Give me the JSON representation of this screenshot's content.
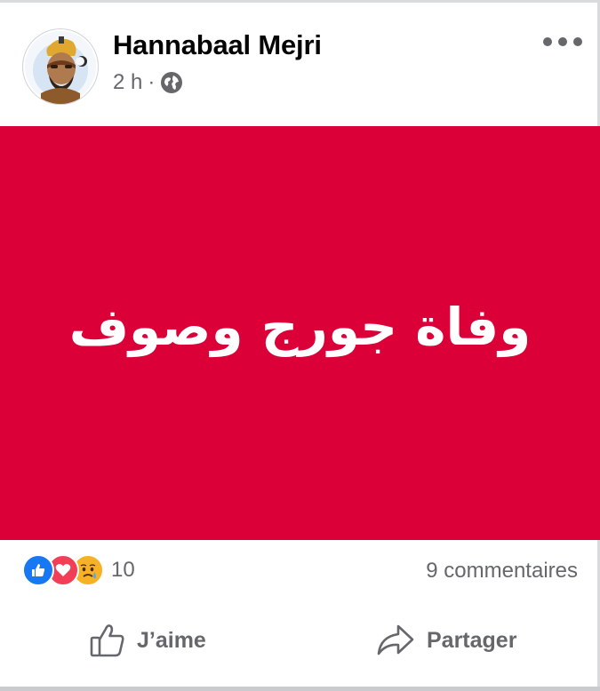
{
  "post": {
    "author": "Hannabaal Mejri",
    "time": "2 h",
    "separator": "·",
    "privacy_icon": "globe-icon",
    "more_icon": "more-options-icon",
    "image_text": "وفاة جورج وصوف",
    "image_background": "#dc0038"
  },
  "reactions": {
    "icons": [
      "like-reaction-icon",
      "love-reaction-icon",
      "sad-reaction-icon"
    ],
    "count": "10",
    "comments": "9 commentaires"
  },
  "actions": {
    "like_label": "J’aime",
    "share_label": "Partager"
  },
  "colors": {
    "like_blue": "#1877f2",
    "love_red": "#f33e58",
    "sad_yellow": "#f7b125",
    "secondary_text": "#65676b"
  }
}
